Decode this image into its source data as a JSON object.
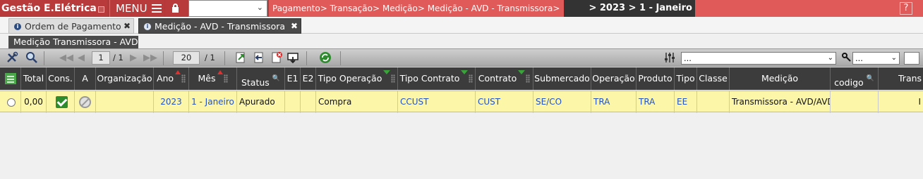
{
  "topbar": {
    "app_title": "Gestão E.Elétrica",
    "menu_label": "MENU",
    "breadcrumb": "Pagamento> Transação> Medição> Medição - AVD - Transmissora>",
    "breadcrumb_date": "> 2023 > 1 - Janeiro",
    "help": "?"
  },
  "tabs": [
    {
      "label": "Ordem de Pagamento",
      "active": false
    },
    {
      "label": "Medição - AVD - Transmissora",
      "active": true
    }
  ],
  "subtitle": "Medição Transmissora - AVD",
  "pager": {
    "page": "1",
    "pages": "/ 1",
    "page_size": "20",
    "total_pages": "/ 1"
  },
  "toolbar_filter": {
    "select1": "...",
    "select2": "..."
  },
  "grid": {
    "columns": [
      "Total",
      "Cons.",
      "A",
      "Organização",
      "Ano",
      "Mês",
      "Status",
      "E1",
      "E2",
      "Tipo Operação",
      "Tipo Contrato",
      "Contrato",
      "Submercado",
      "Operação",
      "Produto",
      "Tipo",
      "Classe",
      "Medição",
      "codigo",
      "Trans"
    ],
    "row": {
      "total": "0,00",
      "organizacao": "",
      "ano": "2023",
      "mes": "1 - Janeiro",
      "status": "Apurado",
      "e1": "",
      "e2": "",
      "tipo_operacao": "Compra",
      "tipo_contrato": "CCUST",
      "contrato": "CUST",
      "submercado": "SE/CO",
      "operacao": "TRA",
      "produto": "TRA",
      "tipo": "EE",
      "classe": "",
      "medicao": "Transmissora - AVD/AVD",
      "codigo": "",
      "trans": "I"
    }
  },
  "colors": {
    "topbar": "#b93a3a",
    "breadcrumb": "#e05a5a",
    "header": "#3c3c3c",
    "selected_row": "#fcf6a8",
    "link": "#2453c4"
  }
}
